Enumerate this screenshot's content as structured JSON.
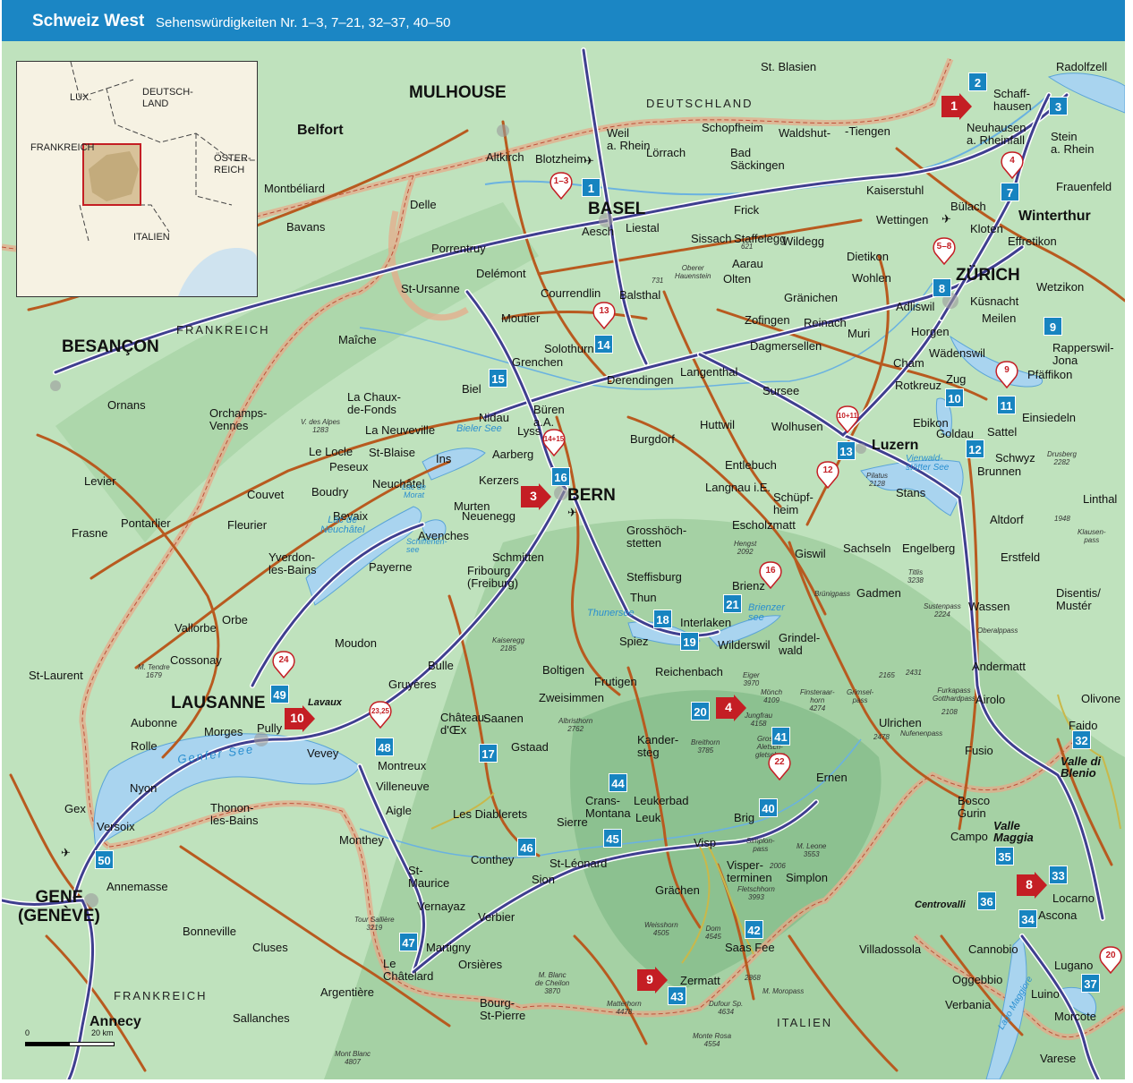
{
  "header": {
    "title": "Schweiz West",
    "subtitle": "Sehenswürdigkeiten Nr. 1–3, 7–21, 32–37, 40–50"
  },
  "colors": {
    "header_bg": "#1b86c4",
    "land": "#bfe2bd",
    "water": "#a9d4ef",
    "road_main": "#3f3f8f",
    "road_secondary": "#b85a1f",
    "border": "#e8a888",
    "marker_blue": "#1784c0",
    "marker_red": "#c41e24"
  },
  "inset": {
    "labels": {
      "lux": "LUX.",
      "deutschland": "DEUTSCH-\nLAND",
      "frankreich": "FRANKREICH",
      "osterreich": "ÖSTER-\nREICH",
      "italien": "ITALIEN"
    }
  },
  "countries": {
    "deutschland": "DEUTSCHLAND",
    "frankreich_n": "FRANKREICH",
    "frankreich_s": "FRANKREICH",
    "italien": "ITALIEN"
  },
  "major_cities": {
    "basel": "BASEL",
    "mulhouse": "MULHOUSE",
    "zurich": "ZÜRICH",
    "bern": "BERN",
    "besancon": "BESANÇON",
    "lausanne": "LAUSANNE",
    "genf": "GENF\n(GENÈVE)"
  },
  "bold_towns": {
    "belfort": "Belfort",
    "winterthur": "Winterthur",
    "luzern": "Luzern",
    "annecy": "Annecy"
  },
  "towns": {
    "radolfzell": "Radolfzell",
    "st_blasien": "St. Blasien",
    "schaffhausen": "Schaff-\nhausen",
    "neuhausen": "Neuhausen\na. Rheinfall",
    "stein": "Stein\na. Rhein",
    "frauenfeld": "Frauenfeld",
    "weil": "Weil\na. Rhein",
    "lorrach": "Lörrach",
    "schopfheim": "Schopfheim",
    "waldshut": "Waldshut-",
    "tiengen": "-Tiengen",
    "bad_sackingen": "Bad\nSäckingen",
    "altkirch": "Altkirch",
    "blotzheim": "Blotzheim",
    "kaiserstuhl": "Kaiserstuhl",
    "bulach": "Bülach",
    "wettingen": "Wettingen",
    "kloten": "Kloten",
    "effretikon": "Effretikon",
    "montbeliard": "Montbéliard",
    "delle": "Delle",
    "bavans": "Bavans",
    "aesch": "Aesch",
    "liestal": "Liestal",
    "frick": "Frick",
    "sissach": "Sissach",
    "wildegg": "Wildegg",
    "staffelegg": "Staffelegg",
    "porrentruy": "Porrentruy",
    "delemont": "Delémont",
    "aarau": "Aarau",
    "olten": "Olten",
    "dietikon": "Dietikon",
    "wohlen": "Wohlen",
    "wetzikon": "Wetzikon",
    "st_ursanne": "St-Ursanne",
    "courrendlin": "Courrendlin",
    "balsthal": "Balsthal",
    "granichen": "Gränichen",
    "kusnacht": "Küsnacht",
    "adliswil": "Adliswil",
    "meilen": "Meilen",
    "moutier": "Moutier",
    "zofingen": "Zofingen",
    "reinach": "Reinach",
    "muri": "Muri",
    "horgen": "Horgen",
    "wadenswil": "Wädenswil",
    "rapperswil": "Rapperswil-\nJona",
    "maiche": "Maîche",
    "solothurn": "Solothurn",
    "grenchen": "Grenchen",
    "dagmersellen": "Dagmersellen",
    "cham": "Cham",
    "pfaffikon": "Pfäffikon",
    "biel": "Biel",
    "derendingen": "Derendingen",
    "langenthal": "Langenthal",
    "sursee": "Sursee",
    "rotkreuz": "Rotkreuz",
    "zug": "Zug",
    "ornans": "Ornans",
    "la_chaux": "La Chaux-\nde-Fonds",
    "nidau": "Nidau",
    "buren": "Büren\na.A.",
    "huttwil": "Huttwil",
    "wolhusen": "Wolhusen",
    "ebikon": "Ebikon",
    "einsiedeln": "Einsiedeln",
    "orchamps": "Orchamps-\nVennes",
    "la_neuveville": "La Neuveville",
    "lyss": "Lyss",
    "burgdorf": "Burgdorf",
    "goldau": "Goldau",
    "sattel": "Sattel",
    "le_locle": "Le Locle",
    "peseux": "Peseux",
    "st_blaise": "St-Blaise",
    "ins": "Ins",
    "aarberg": "Aarberg",
    "entlebuch": "Entlebuch",
    "schwyz": "Schwyz",
    "brunnen": "Brunnen",
    "levier": "Levier",
    "neuchatel": "Neuchâtel",
    "kerzers": "Kerzers",
    "langnau": "Langnau i.E.",
    "stans": "Stans",
    "couvet": "Couvet",
    "boudry": "Boudry",
    "murten": "Murten",
    "neuenegg": "Neuenegg",
    "schupfheim": "Schüpf-\nheim",
    "linthal": "Linthal",
    "pontarlier": "Pontarlier",
    "bevaix": "Bevaix",
    "fleurier": "Fleurier",
    "escholzmatt": "Escholzmatt",
    "altdorf": "Altdorf",
    "frasne": "Frasne",
    "avenches": "Avenches",
    "grosshochstetten": "Grosshöch-\nstetten",
    "sachseln": "Sachseln",
    "engelberg": "Engelberg",
    "giswil": "Giswil",
    "yverdon": "Yverdon-\nles-Bains",
    "payerne": "Payerne",
    "schmitten": "Schmitten",
    "erstfeld": "Erstfeld",
    "fribourg": "Fribourg\n(Freiburg)",
    "steffisburg": "Steffisburg",
    "brienz": "Brienz",
    "gadmen": "Gadmen",
    "disentis": "Disentis/\nMustér",
    "thun": "Thun",
    "interlaken": "Interlaken",
    "wassen": "Wassen",
    "vallorbe": "Vallorbe",
    "orbe": "Orbe",
    "spiez": "Spiez",
    "wilderswil": "Wilderswil",
    "moudon": "Moudon",
    "grindelwald": "Grindel-\nwald",
    "reichenbach": "Reichenbach",
    "andermatt": "Andermatt",
    "cossonay": "Cossonay",
    "bulle": "Bulle",
    "boltigen": "Boltigen",
    "st_laurent": "St-Laurent",
    "frutigen": "Frutigen",
    "gruyeres": "Gruyères",
    "airolo": "Airolo",
    "olivone": "Olivone",
    "zweisimmen": "Zweisimmen",
    "aubonne": "Aubonne",
    "pully": "Pully",
    "chateau_doex": "Château-\nd'Œx",
    "saanen": "Saanen",
    "morges": "Morges",
    "vevey": "Vevey",
    "ulrichen": "Ulrichen",
    "faido": "Faido",
    "rolle": "Rolle",
    "gstaad": "Gstaad",
    "kandersteg": "Kander-\nsteg",
    "montreux": "Montreux",
    "fusio": "Fusio",
    "villeneuve": "Villeneuve",
    "nyon": "Nyon",
    "ernen": "Ernen",
    "crans": "Crans-\nMontana",
    "leukerbad": "Leukerbad",
    "gex": "Gex",
    "versoix": "Versoix",
    "thonon": "Thonon-\nles-Bains",
    "aigle": "Aigle",
    "les_diablerets": "Les Diablerets",
    "brig": "Brig",
    "bosco": "Bosco\nGurin",
    "sierre": "Sierre",
    "leuk": "Leuk",
    "campo": "Campo",
    "monthey": "Monthey",
    "visp": "Visp",
    "annemasse": "Annemasse",
    "conthey": "Conthey",
    "st_leonard": "St-Léonard",
    "sion": "Sion",
    "st_maurice": "St-\nMaurice",
    "simplon": "Simplon",
    "visperterminen": "Visper-\nterminen",
    "locarno": "Locarno",
    "ascona": "Ascona",
    "grachen": "Grächen",
    "vernayaz": "Vernayaz",
    "bonneville": "Bonneville",
    "verbier": "Verbier",
    "cluses": "Cluses",
    "saas_fee": "Saas Fee",
    "martigny": "Martigny",
    "villadossola": "Villadossola",
    "cannobio": "Cannobio",
    "orsieres": "Orsières",
    "le_chatelard": "Le\nChâtelard",
    "oggebbio": "Oggebbio",
    "lugano": "Lugano",
    "zermatt": "Zermatt",
    "argentiere": "Argentière",
    "bourg": "Bourg-\nSt-Pierre",
    "verbania": "Verbania",
    "luino": "Luino",
    "sallanches": "Sallanches",
    "morcote": "Morcote",
    "varese": "Varese"
  },
  "regions": {
    "lavaux": "Lavaux",
    "valle_di_blenio": "Valle di\nBlenio",
    "valle_maggia": "Valle\nMaggia",
    "centrovalli": "Centrovalli"
  },
  "lakes": {
    "genfer_see": "Genfer See",
    "bieler_see": "Bieler See",
    "lac_de_neuchatel": "Lac de\nNeuchâtel",
    "lac_de_morat": "Lac de\nMorat",
    "schiffenensee": "Schiffenen-\nsee",
    "thunersee": "Thunersee",
    "brienzersee": "Brienzer\nsee",
    "vierwaldstaetter": "Vierwald-\nstätter See",
    "lago_maggiore": "Lago Maggiore"
  },
  "mountains": {
    "v_des_alpes": "V. des Alpes\n1283",
    "hengst": "Hengst\n2092",
    "titlis": "Titlis\n3238",
    "drusberg": "Drusberg\n2282",
    "klausenpass": "Klausen-\npass",
    "m1948": "1948",
    "brunigpass": "Brünigpass",
    "sustenpass": "Sustenpass\n2224",
    "oberalppass": "Oberalppass",
    "kaiseregg": "Kaiseregg\n2185",
    "m_tendre": "M. Tendre\n1679",
    "eiger": "Eiger\n3970",
    "monch": "Mönch\n4109",
    "finsteraarhorn": "Finsteraar-\nhorn\n4274",
    "jungfrau": "Jungfrau\n4158",
    "grimselpass": "Grimsel-\npass",
    "furkapass": "Furkapass\nGotthardpass",
    "m2431": "2431",
    "m2165": "2165",
    "m2108": "2108",
    "m2478": "2478",
    "nufenenpass": "Nufenenpass",
    "breithorn": "Breithorn\n3785",
    "aletsch": "Grosser\nAletsch-\ngletscher",
    "albristhorn": "Albristhorn\n2762",
    "m_leone": "M. Leone\n3553",
    "simplonpass": "Simplon-\npass",
    "m2006": "2006",
    "weisshorn": "Weisshorn\n4505",
    "dom": "Dom\n4545",
    "fletschhorn": "Fletschhorn\n3993",
    "tour_sallière": "Tour Sallière\n3219",
    "m_blanc_de_cheilon": "M. Blanc\nde Cheilon\n3870",
    "matterhorn": "Matterhorn\n4478",
    "dufour": "Dufour Sp.\n4634",
    "monte_rosa": "Monte Rosa\n4554",
    "m_moropass": "M. Moropass",
    "m2868": "2868",
    "mont_blanc": "Mont Blanc\n4807",
    "pilatus": "Pilatus\n2128",
    "oberer_hauenstein": "Oberer\nHauenstein",
    "m731": "731",
    "m621": "621"
  },
  "markers_blue": [
    "1",
    "2",
    "3",
    "7",
    "8",
    "9",
    "10",
    "11",
    "12",
    "13",
    "14",
    "15",
    "16",
    "17",
    "18",
    "19",
    "20",
    "21",
    "32",
    "33",
    "34",
    "35",
    "36",
    "37",
    "40",
    "41",
    "42",
    "43",
    "44",
    "45",
    "46",
    "47",
    "48",
    "49",
    "50"
  ],
  "markers_arrow": [
    "1",
    "3",
    "4",
    "8",
    "9",
    "10"
  ],
  "markers_pin": [
    "1–3",
    "4",
    "5–8",
    "9",
    "10+11",
    "12",
    "13",
    "14+15",
    "16",
    "20",
    "22",
    "23,25",
    "24"
  ],
  "scale": {
    "start": "0",
    "end": "20 km"
  }
}
